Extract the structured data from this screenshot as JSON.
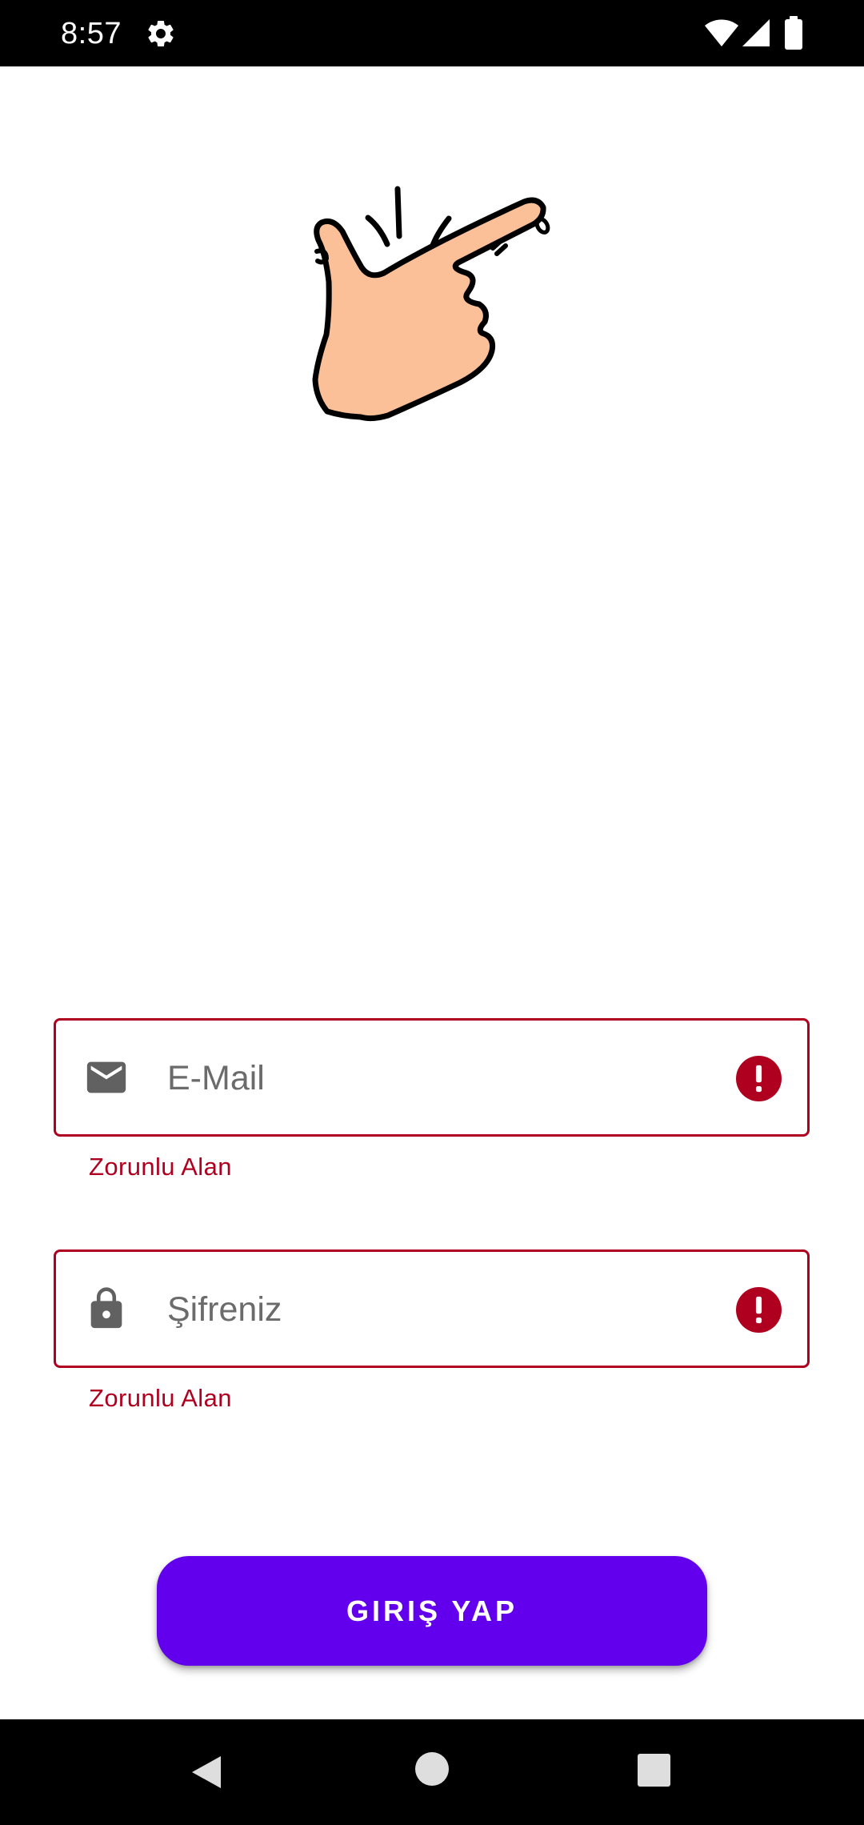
{
  "status_bar": {
    "time": "8:57",
    "icons": [
      "gear-icon",
      "wifi-icon",
      "signal-icon",
      "battery-icon"
    ]
  },
  "illustration": {
    "icon": "snapping-hand-illustration",
    "skin_color": "#fbc097"
  },
  "form": {
    "email": {
      "placeholder": "E-Mail",
      "value": "",
      "leading_icon": "mail-icon",
      "trailing_icon": "error-icon",
      "error": "Zorunlu Alan"
    },
    "password": {
      "placeholder": "Şifreniz",
      "value": "",
      "leading_icon": "lock-icon",
      "trailing_icon": "error-icon",
      "error": "Zorunlu Alan"
    }
  },
  "login_button": {
    "label": "GIRIŞ YAP"
  },
  "colors": {
    "primary": "#6200ee",
    "error": "#b00020",
    "icon_gray": "#616161"
  },
  "nav_bar": {
    "icons": [
      "back-icon",
      "home-icon",
      "recents-icon"
    ]
  }
}
